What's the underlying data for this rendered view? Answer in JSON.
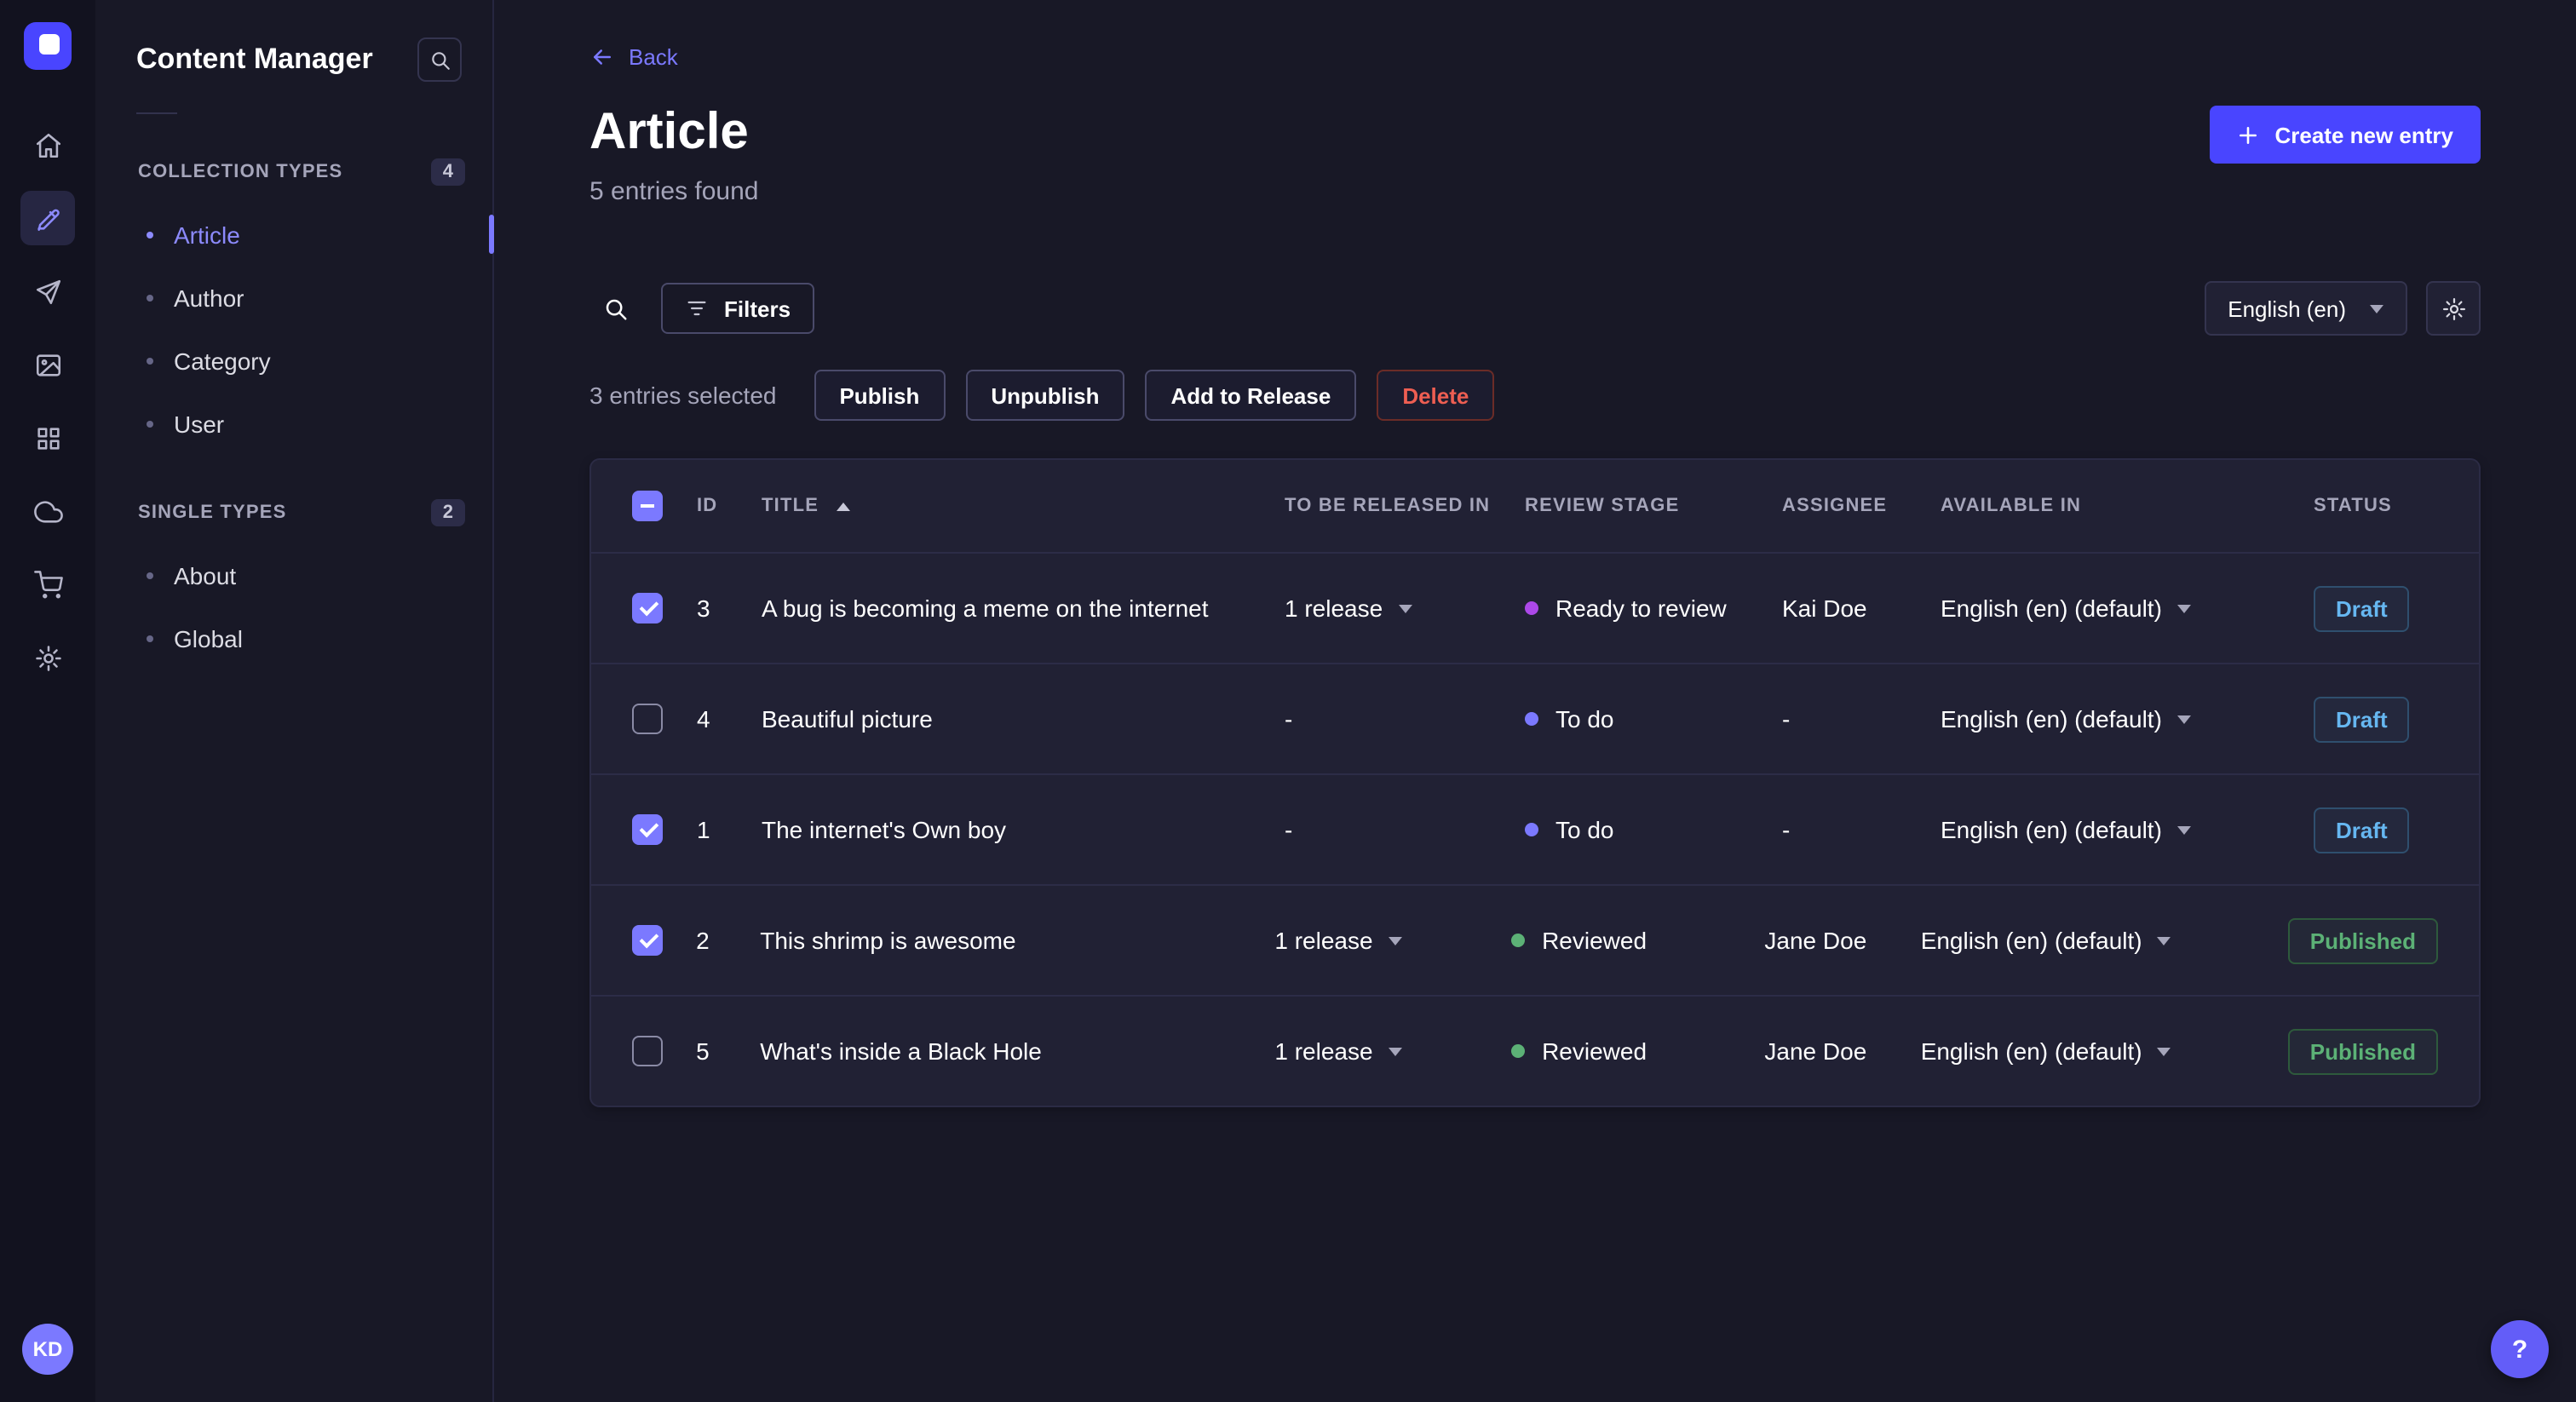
{
  "colors": {
    "primary": "#4945ff",
    "link": "#7b79ff",
    "draft_text": "#66b7f1",
    "published_text": "#5cb176",
    "danger_text": "#ee5e52"
  },
  "nav_rail": {
    "avatar_initials": "KD",
    "icons": [
      "home",
      "content-manager",
      "releases",
      "media-library",
      "content-type-builder",
      "cloud",
      "marketplace",
      "settings"
    ]
  },
  "subnav": {
    "title": "Content Manager",
    "sections": [
      {
        "label": "COLLECTION TYPES",
        "badge": "4",
        "items": [
          {
            "label": "Article",
            "active": true
          },
          {
            "label": "Author",
            "active": false
          },
          {
            "label": "Category",
            "active": false
          },
          {
            "label": "User",
            "active": false
          }
        ]
      },
      {
        "label": "SINGLE TYPES",
        "badge": "2",
        "items": [
          {
            "label": "About",
            "active": false
          },
          {
            "label": "Global",
            "active": false
          }
        ]
      }
    ]
  },
  "header": {
    "back_label": "Back",
    "title": "Article",
    "subtitle": "5 entries found",
    "create_button_label": "Create new entry"
  },
  "toolbar": {
    "filters_label": "Filters",
    "locale_label": "English (en)"
  },
  "selection": {
    "text": "3 entries selected",
    "publish_label": "Publish",
    "unpublish_label": "Unpublish",
    "add_to_release_label": "Add to Release",
    "delete_label": "Delete"
  },
  "table": {
    "columns": [
      "ID",
      "TITLE",
      "TO BE RELEASED IN",
      "REVIEW STAGE",
      "ASSIGNEE",
      "AVAILABLE IN",
      "STATUS"
    ],
    "rows": [
      {
        "checked": true,
        "id": "3",
        "title": "A bug is becoming a meme on the internet",
        "release": "1 release",
        "release_caret": true,
        "review_stage": "Ready to review",
        "review_color": "#ac48e8",
        "assignee": "Kai Doe",
        "available_in": "English (en) (default)",
        "status": "Draft"
      },
      {
        "checked": false,
        "id": "4",
        "title": "Beautiful picture",
        "release": "-",
        "release_caret": false,
        "review_stage": "To do",
        "review_color": "#7b79ff",
        "assignee": "-",
        "available_in": "English (en) (default)",
        "status": "Draft"
      },
      {
        "checked": true,
        "id": "1",
        "title": "The internet's Own boy",
        "release": "-",
        "release_caret": false,
        "review_stage": "To do",
        "review_color": "#7b79ff",
        "assignee": "-",
        "available_in": "English (en) (default)",
        "status": "Draft"
      },
      {
        "checked": true,
        "id": "2",
        "title": "This shrimp is awesome",
        "release": "1 release",
        "release_caret": true,
        "review_stage": "Reviewed",
        "review_color": "#5cb176",
        "assignee": "Jane Doe",
        "available_in": "English (en) (default)",
        "status": "Published"
      },
      {
        "checked": false,
        "id": "5",
        "title": "What's inside a Black Hole",
        "release": "1 release",
        "release_caret": true,
        "review_stage": "Reviewed",
        "review_color": "#5cb176",
        "assignee": "Jane Doe",
        "available_in": "English (en) (default)",
        "status": "Published"
      }
    ]
  },
  "help": {
    "label": "?"
  }
}
